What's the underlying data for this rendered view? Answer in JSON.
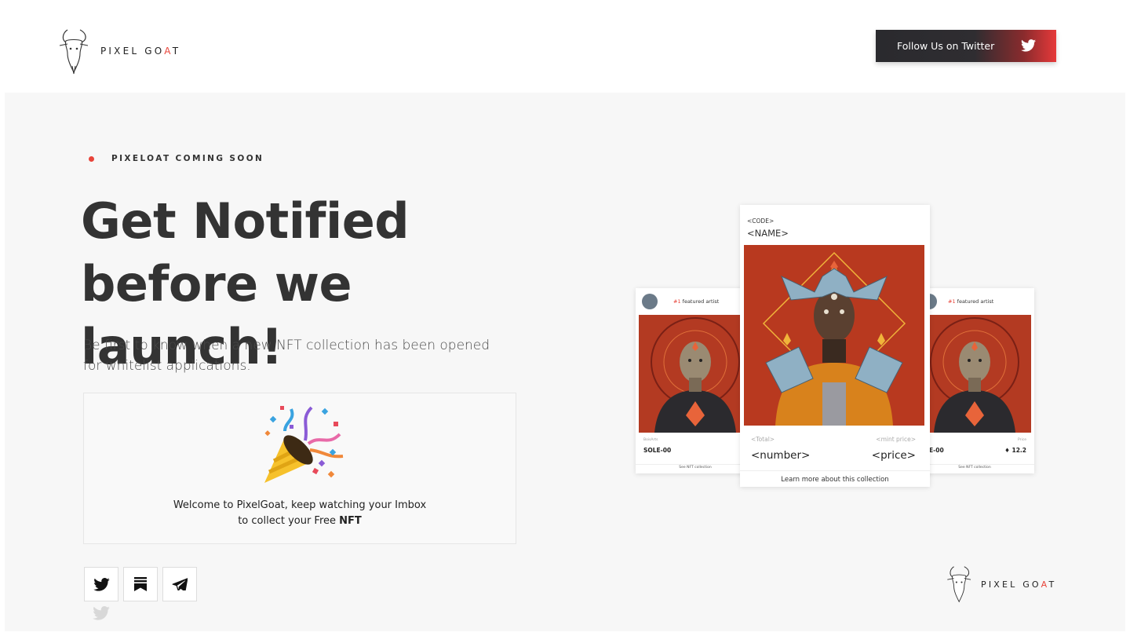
{
  "brand": {
    "name_prefix": "PIXEL GO",
    "name_accent": "A",
    "name_suffix": "T",
    "accent_color": "#e8443a"
  },
  "header": {
    "twitter_button_label": "Follow Us on Twitter",
    "twitter_icon": "twitter-icon"
  },
  "hero": {
    "eyebrow": "PIXELOAT COMING SOON",
    "headline_line1": "Get Notified",
    "headline_line2": "before we launch!",
    "subtitle": "Be first to know when a new NFT collection has been opened for whitelist applications."
  },
  "welcome": {
    "icon": "party-popper-icon",
    "line1": "Welcome to PixelGoat, keep watching your Imbox",
    "line2_prefix": "to collect your Free ",
    "line2_bold": "NFT"
  },
  "socials": [
    {
      "name": "twitter-icon"
    },
    {
      "name": "substack-icon"
    },
    {
      "name": "telegram-icon"
    }
  ],
  "cards": {
    "left": {
      "featured_hash": "#1",
      "featured_text": " featured artist",
      "meta_left": "BoisArts",
      "meta_right": "",
      "code": "SOLE-00",
      "price": "",
      "see": "See NFT collection"
    },
    "right": {
      "featured_hash": "#1",
      "featured_text": " featured artist",
      "meta_left": "",
      "meta_right": "Price",
      "code": "E-00",
      "price": "12.2",
      "see": "See NFT collection"
    },
    "main": {
      "code": "<CODE>",
      "name": "<NAME>",
      "total_label": "<Total>",
      "price_label": "<mint price>",
      "number": "<number>",
      "price": "<price>",
      "learn": "Learn more about this collection"
    }
  }
}
